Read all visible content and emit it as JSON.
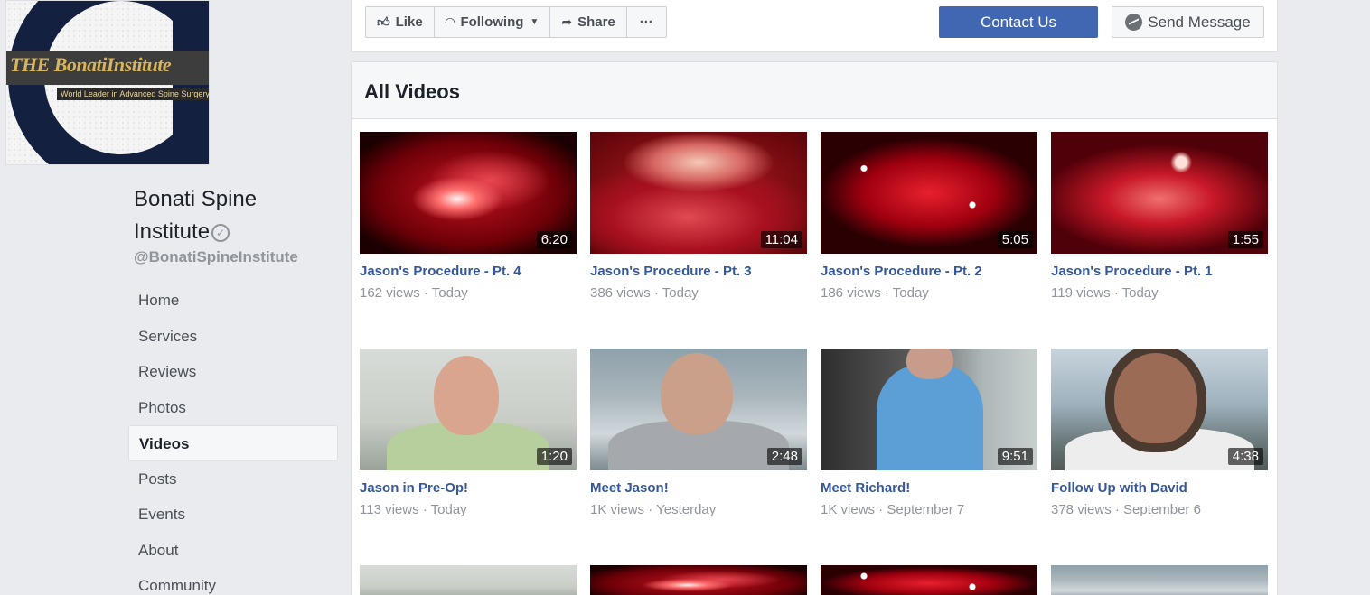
{
  "page": {
    "name_line1": "Bonati Spine",
    "name_line2": "Institute",
    "handle": "@BonatiSpineInstitute",
    "cover_brand": "THE BonatiInstitute",
    "cover_tagline": "World Leader in Advanced Spine Surgery"
  },
  "nav": [
    {
      "label": "Home",
      "active": false
    },
    {
      "label": "Services",
      "active": false
    },
    {
      "label": "Reviews",
      "active": false
    },
    {
      "label": "Photos",
      "active": false
    },
    {
      "label": "Videos",
      "active": true
    },
    {
      "label": "Posts",
      "active": false
    },
    {
      "label": "Events",
      "active": false
    },
    {
      "label": "About",
      "active": false
    },
    {
      "label": "Community",
      "active": false
    }
  ],
  "actions": {
    "like": "Like",
    "following": "Following",
    "share": "Share",
    "more": "···",
    "contact": "Contact Us",
    "send": "Send Message"
  },
  "section": {
    "title": "All Videos"
  },
  "videos": [
    {
      "title": "Jason's Procedure - Pt. 4",
      "views": "162 views",
      "date": "Today",
      "duration": "6:20",
      "thumb": "surg"
    },
    {
      "title": "Jason's Procedure - Pt. 3",
      "views": "386 views",
      "date": "Today",
      "duration": "11:04",
      "thumb": "surg2"
    },
    {
      "title": "Jason's Procedure - Pt. 2",
      "views": "186 views",
      "date": "Today",
      "duration": "5:05",
      "thumb": "surg3"
    },
    {
      "title": "Jason's Procedure - Pt. 1",
      "views": "119 views",
      "date": "Today",
      "duration": "1:55",
      "thumb": "surg4"
    },
    {
      "title": "Jason in Pre-Op!",
      "views": "113 views",
      "date": "Today",
      "duration": "1:20",
      "thumb": "p-room"
    },
    {
      "title": "Meet Jason!",
      "views": "1K views",
      "date": "Yesterday",
      "duration": "2:48",
      "thumb": "p-outdoor"
    },
    {
      "title": "Meet Richard!",
      "views": "1K views",
      "date": "September 7",
      "duration": "9:51",
      "thumb": "p-dark"
    },
    {
      "title": "Follow Up with David",
      "views": "378 views",
      "date": "September 6",
      "duration": "4:38",
      "thumb": "p-palm"
    }
  ],
  "partial_row": [
    "p-room",
    "surg",
    "surg3",
    "p-outdoor"
  ],
  "colors": {
    "brand_blue": "#4267b2",
    "link_blue": "#365899",
    "muted": "#90949c",
    "background": "#e9ebee"
  },
  "separator": " · "
}
